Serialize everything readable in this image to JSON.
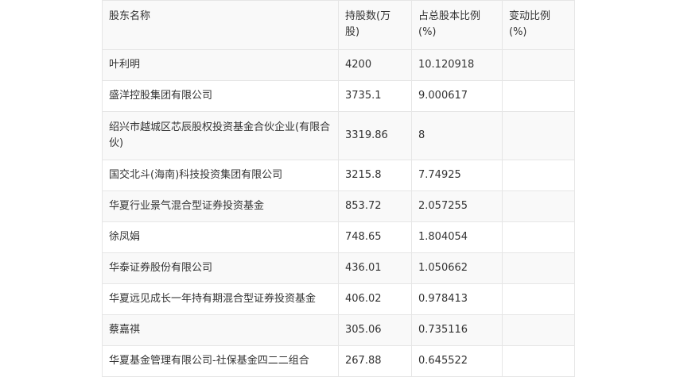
{
  "table": {
    "headers": [
      "股东名称",
      "持股数(万股)",
      "占总股本比例(%)",
      "变动比例(%)"
    ],
    "rows": [
      [
        "叶利明",
        "4200",
        "10.120918",
        ""
      ],
      [
        "盛洋控股集团有限公司",
        "3735.1",
        "9.000617",
        ""
      ],
      [
        "绍兴市越城区芯辰股权投资基金合伙企业(有限合伙)",
        "3319.86",
        "8",
        ""
      ],
      [
        "国交北斗(海南)科技投资集团有限公司",
        "3215.8",
        "7.74925",
        ""
      ],
      [
        "华夏行业景气混合型证券投资基金",
        "853.72",
        "2.057255",
        ""
      ],
      [
        "徐凤娟",
        "748.65",
        "1.804054",
        ""
      ],
      [
        "华泰证券股份有限公司",
        "436.01",
        "1.050662",
        ""
      ],
      [
        "华夏远见成长一年持有期混合型证券投资基金",
        "406.02",
        "0.978413",
        ""
      ],
      [
        "蔡嘉祺",
        "305.06",
        "0.735116",
        ""
      ],
      [
        "华夏基金管理有限公司-社保基金四二二组合",
        "267.88",
        "0.645522",
        ""
      ]
    ]
  }
}
